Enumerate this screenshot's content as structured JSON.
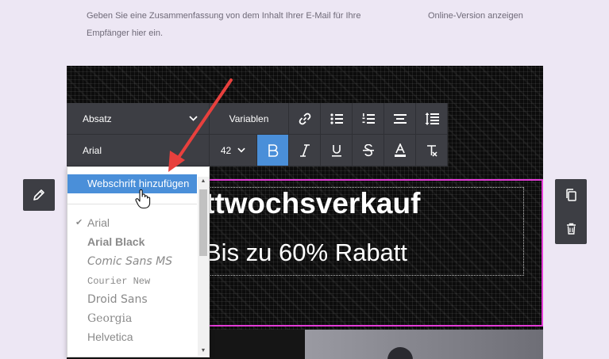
{
  "preheader": {
    "text": "Geben Sie eine Zusammenfassung von dem Inhalt Ihrer E-Mail für Ihre Empfänger hier ein.",
    "online_link": "Online-Version anzeigen"
  },
  "hero": {
    "headline": "ttwochsverkauf",
    "subline": "Bis zu 60% Rabatt"
  },
  "toolbar": {
    "paragraph_label": "Absatz",
    "variables_label": "Variablen",
    "font_label": "Arial",
    "size_label": "42",
    "icons": {
      "link": "link-icon",
      "bullet_list": "bullet-list-icon",
      "numbered_list": "numbered-list-icon",
      "align": "align-center-icon",
      "line_height": "line-height-icon",
      "bold": "bold-icon",
      "italic": "italic-icon",
      "underline": "underline-icon",
      "strike": "strikethrough-icon",
      "text_color": "text-color-icon",
      "clear_format": "clear-format-icon"
    },
    "colors": {
      "background": "#3d3e44",
      "active": "#4a8fd9"
    }
  },
  "font_dropdown": {
    "add_label": "Webschrift hinzufügen",
    "fonts": [
      "Arial",
      "Arial Black",
      "Comic Sans MS",
      "Courier New",
      "Droid Sans",
      "Georgia",
      "Helvetica"
    ],
    "selected": "Arial"
  },
  "side_actions": {
    "edit_icon": "pencil-icon",
    "duplicate_icon": "duplicate-icon",
    "delete_icon": "trash-icon"
  },
  "colors": {
    "selection_border": "#e23cd6",
    "page_bg": "#ede7f4"
  }
}
